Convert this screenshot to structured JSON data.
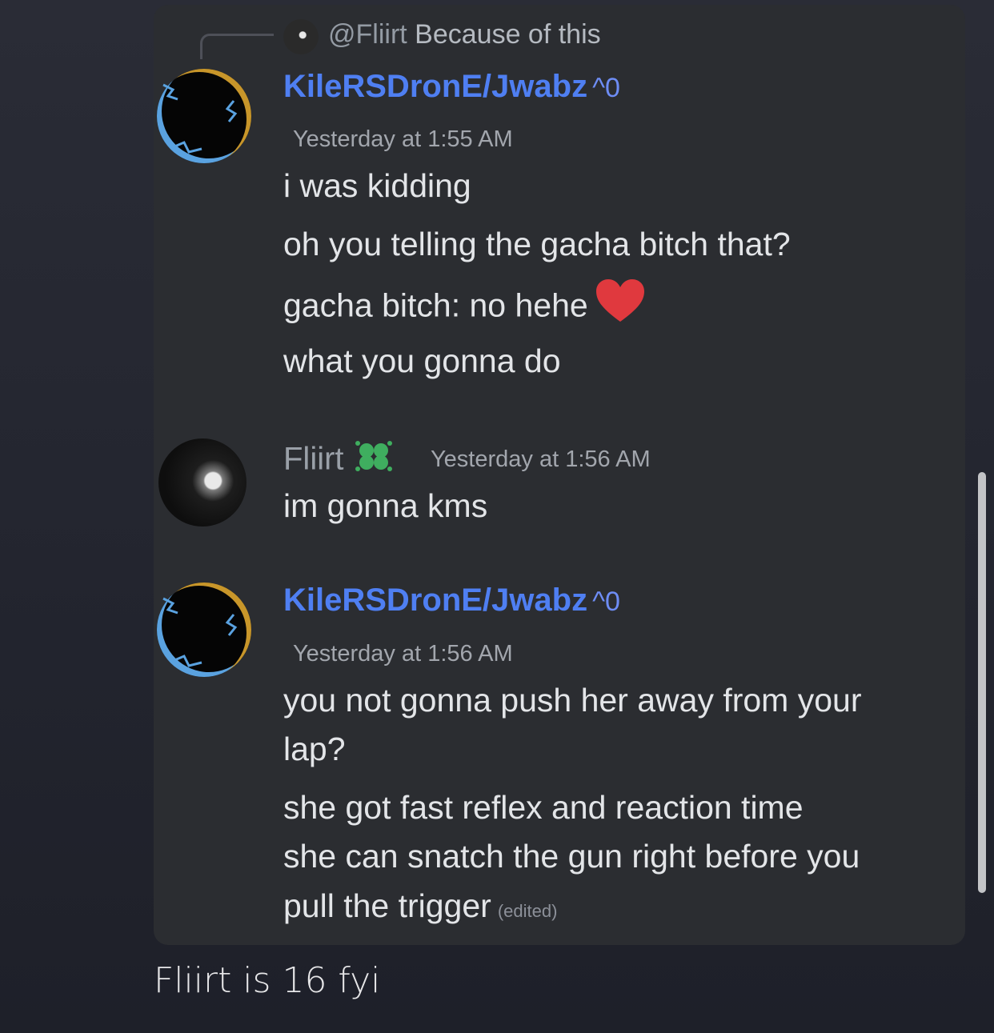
{
  "reply": {
    "mention": "@Fliirt",
    "text": "Because of this"
  },
  "messages": [
    {
      "author": "KileRSDronE/Jwabz",
      "tag": "^0",
      "time": "Yesterday at 1:55 AM",
      "lines": [
        "i was kidding",
        "oh you telling the gacha bitch that?",
        "gacha bitch: no hehe",
        "what you gonna do"
      ]
    },
    {
      "author": "Fliirt",
      "time": "Yesterday at 1:56 AM",
      "lines": [
        "im gonna kms"
      ]
    },
    {
      "author": "KileRSDronE/Jwabz",
      "tag": "^0",
      "time": "Yesterday at 1:56 AM",
      "lines": [
        "you not gonna push her away from your",
        "lap?",
        "she got fast reflex and reaction time",
        "she can snatch the gun right before you",
        "pull the trigger"
      ],
      "edited": "(edited)"
    }
  ],
  "caption": "Fliirt is 16 fyi",
  "colors": {
    "background": "#23252f",
    "card": "#2b2d31",
    "username_blue": "#4f7ff2",
    "heart": "#e0393e",
    "badge_green": "#3fae5f"
  },
  "icons": {
    "heart": "red-heart-emoji",
    "badge": "green-clover-badge-icon"
  }
}
